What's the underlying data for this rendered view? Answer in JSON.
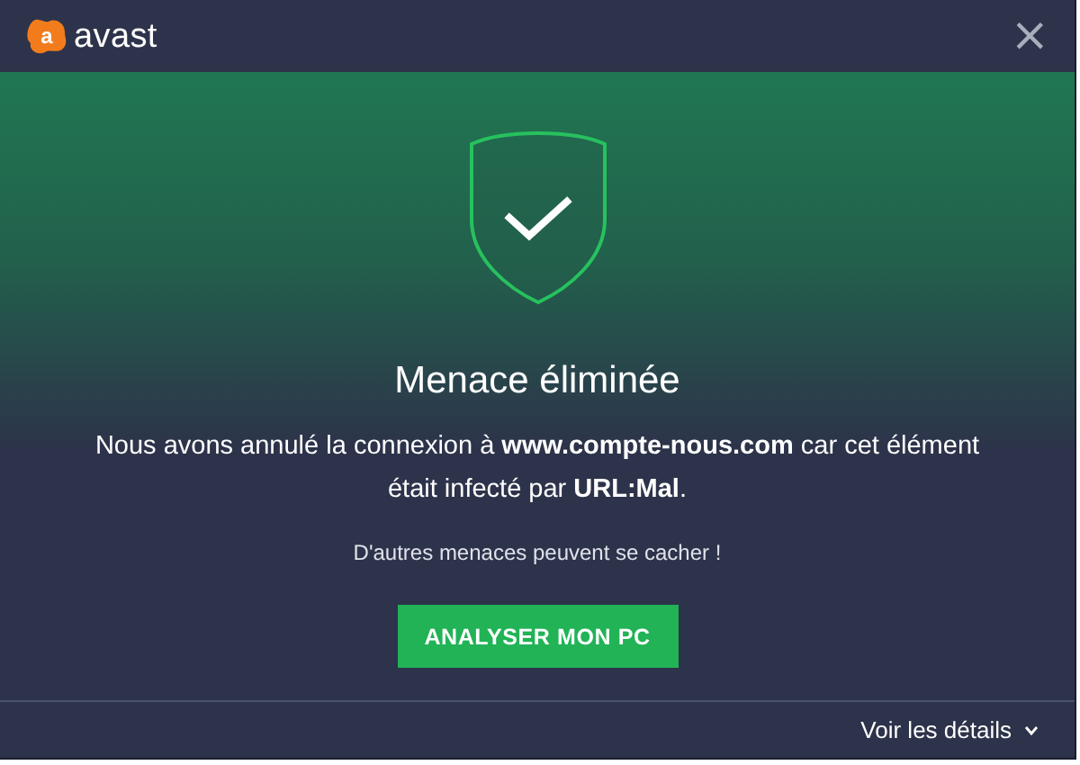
{
  "header": {
    "logo_mark": "a",
    "logo_text": "avast",
    "close": "×"
  },
  "alert": {
    "title": "Menace éliminée",
    "message": "Nous avons annulé la connexion à **www.compte-nous.com** car cet élément était infecté par **URL:Mal**.",
    "hint": "D'autres menaces peuvent se cacher !",
    "button": "ANALYSER MON PC"
  },
  "footer": {
    "details": "Voir les détails",
    "expanded": false
  }
}
